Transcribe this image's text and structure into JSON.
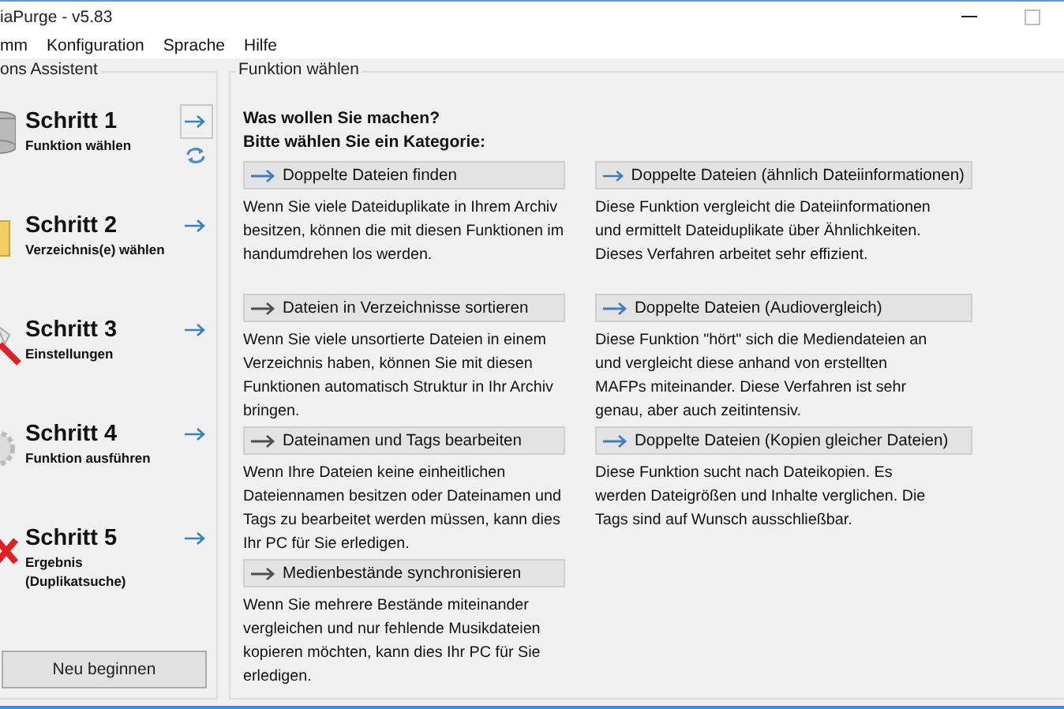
{
  "window": {
    "title": "iaPurge - v5.83"
  },
  "menu": [
    "mm",
    "Konfiguration",
    "Sprache",
    "Hilfe"
  ],
  "wizard": {
    "title": "ons Assistent",
    "steps": [
      {
        "title": "Schritt 1",
        "subtitle": "Funktion wählen",
        "selected": true
      },
      {
        "title": "Schritt 2",
        "subtitle": "Verzeichnis(e) wählen",
        "selected": false
      },
      {
        "title": "Schritt 3",
        "subtitle": "Einstellungen",
        "selected": false
      },
      {
        "title": "Schritt 4",
        "subtitle": "Funktion ausführen",
        "selected": false
      },
      {
        "title": "Schritt 5",
        "subtitle": "Ergebnis (Duplikatsuche)",
        "selected": false
      }
    ],
    "restart_button": "Neu beginnen"
  },
  "functions": {
    "title": "Funktion wählen",
    "question": "Was wollen Sie machen?",
    "prompt": "Bitte wählen Sie ein Kategorie:",
    "columns": [
      [
        {
          "label": "Doppelte Dateien finden",
          "color": "#3a7fc2",
          "description": "Wenn Sie viele Dateiduplikate in Ihrem Archiv besitzen, können die mit diesen Funktionen im handumdrehen los werden."
        },
        {
          "label": "Dateien in Verzeichnisse sortieren",
          "color": "#505050",
          "description": "Wenn Sie viele unsortierte Dateien in einem Verzeichnis  haben, können Sie mit diesen Funktionen automatisch  Struktur in Ihr Archiv bringen."
        },
        {
          "label": "Dateinamen und Tags bearbeiten",
          "color": "#505050",
          "description": "Wenn Ihre Dateien keine einheitlichen Dateiennamen besitzen oder Dateinamen und Tags zu bearbeitet werden müssen,  kann dies Ihr PC für Sie erledigen."
        },
        {
          "label": "Medienbestände synchronisieren",
          "color": "#505050",
          "description": "Wenn Sie mehrere Bestände miteinander vergleichen und nur fehlende Musikdateien kopieren möchten, kann dies Ihr PC für Sie erledigen."
        }
      ],
      [
        {
          "label": "Doppelte Dateien (ähnlich Dateiinformationen)",
          "color": "#3a7fc2",
          "description": "Diese Funktion vergleicht die Dateiinformationen und ermittelt Dateiduplikate über Ähnlichkeiten.  Dieses Verfahren arbeitet sehr effizient."
        },
        {
          "label": "Doppelte Dateien (Audiovergleich)",
          "color": "#3a7fc2",
          "description": "Diese Funktion \"hört\" sich die Mediendateien an und vergleicht diese anhand von erstellten MAFPs miteinander.  Diese Verfahren ist sehr genau, aber auch zeitintensiv."
        },
        {
          "label": "Doppelte Dateien (Kopien gleicher Dateien)",
          "color": "#3a7fc2",
          "description": "Diese Funktion sucht nach Dateikopien.  Es werden Dateigrößen und Inhalte verglichen. Die Tags sind auf Wunsch ausschließbar."
        }
      ]
    ]
  }
}
